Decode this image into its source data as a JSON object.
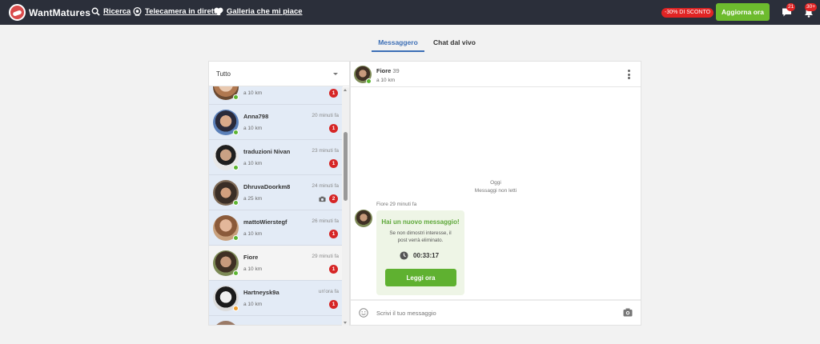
{
  "brand": {
    "name": "WantMatures"
  },
  "nav": [
    {
      "label": "Ricerca",
      "icon": "search-icon"
    },
    {
      "label": "Telecamera in diretta",
      "icon": "webcam-icon"
    },
    {
      "label": "Galleria che mi piace",
      "icon": "heart-icon"
    }
  ],
  "header": {
    "discount": "-30% DI SCONTO",
    "upgrade_label": "Aggiorna ora",
    "messages_count": "21",
    "notifications_count": "30+"
  },
  "tabs": [
    {
      "label": "Messaggero",
      "active": true
    },
    {
      "label": "Chat dal vivo",
      "active": false
    }
  ],
  "filter": {
    "selected": "Tutto"
  },
  "conversations": [
    {
      "name": "",
      "distance": "a 10 km",
      "time": "",
      "badge": "1",
      "photo": false
    },
    {
      "name": "Anna798",
      "distance": "a 10 km",
      "time": "20 minuti fa",
      "badge": "1",
      "photo": false
    },
    {
      "name": "traduzioni Nivan",
      "distance": "a 10 km",
      "time": "23 minuti fa",
      "badge": "1",
      "photo": false
    },
    {
      "name": "DhruvaDoorkm8",
      "distance": "a 25 km",
      "time": "24 minuti fa",
      "badge": "2",
      "photo": true
    },
    {
      "name": "mattoWierstegf",
      "distance": "a 10 km",
      "time": "26 minuti fa",
      "badge": "1",
      "photo": false
    },
    {
      "name": "Fiore",
      "distance": "a 10 km",
      "time": "29 minuti fa",
      "badge": "1",
      "photo": false,
      "selected": true
    },
    {
      "name": "Hartneysk9a",
      "distance": "a 10 km",
      "time": "un'ora fa",
      "badge": "1",
      "photo": false
    },
    {
      "name": "",
      "distance": "",
      "time": "",
      "badge": "",
      "photo": false
    }
  ],
  "chat": {
    "name": "Fiore",
    "age": "39",
    "distance": "a 10 km",
    "date_label": "Oggi",
    "unread_label": "Messaggi non letti",
    "message_meta": "Fiore 29 minuti fa",
    "card_title": "Hai un nuovo messaggio!",
    "card_text": "Se non dimostri interesse, il post verrà eliminato.",
    "timer": "00:33:17",
    "read_button": "Leggi ora",
    "input_placeholder": "Scrivi il tuo messaggio"
  },
  "colors": {
    "topbar": "#2b2f3a",
    "accent_blue": "#3d6fb6",
    "green": "#5fb130",
    "badge_red": "#d62626",
    "unread_row": "#e3ebf6"
  }
}
